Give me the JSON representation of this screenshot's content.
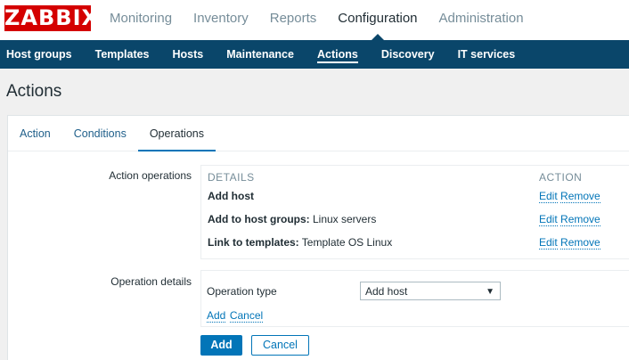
{
  "logo": "ZABBIX",
  "top_nav": [
    "Monitoring",
    "Inventory",
    "Reports",
    "Configuration",
    "Administration"
  ],
  "top_nav_active": "Configuration",
  "sub_nav": [
    "Host groups",
    "Templates",
    "Hosts",
    "Maintenance",
    "Actions",
    "Discovery",
    "IT services"
  ],
  "sub_nav_active": "Actions",
  "page_title": "Actions",
  "tabs": [
    "Action",
    "Conditions",
    "Operations"
  ],
  "active_tab": "Operations",
  "action_operations": {
    "label": "Action operations",
    "header_details": "DETAILS",
    "header_action": "ACTION",
    "rows": [
      {
        "bold": "Add host",
        "rest": "",
        "edit": "Edit",
        "remove": "Remove"
      },
      {
        "bold": "Add to host groups:",
        "rest": " Linux servers",
        "edit": "Edit",
        "remove": "Remove"
      },
      {
        "bold": "Link to templates:",
        "rest": " Template OS Linux",
        "edit": "Edit",
        "remove": "Remove"
      }
    ]
  },
  "operation_details": {
    "label": "Operation details",
    "type_label": "Operation type",
    "type_value": "Add host",
    "add_link": "Add",
    "cancel_link": "Cancel"
  },
  "buttons": {
    "add": "Add",
    "cancel": "Cancel"
  },
  "colors": {
    "brand": "#d40000",
    "nav_bg": "#0a466a",
    "link": "#0275b8"
  }
}
